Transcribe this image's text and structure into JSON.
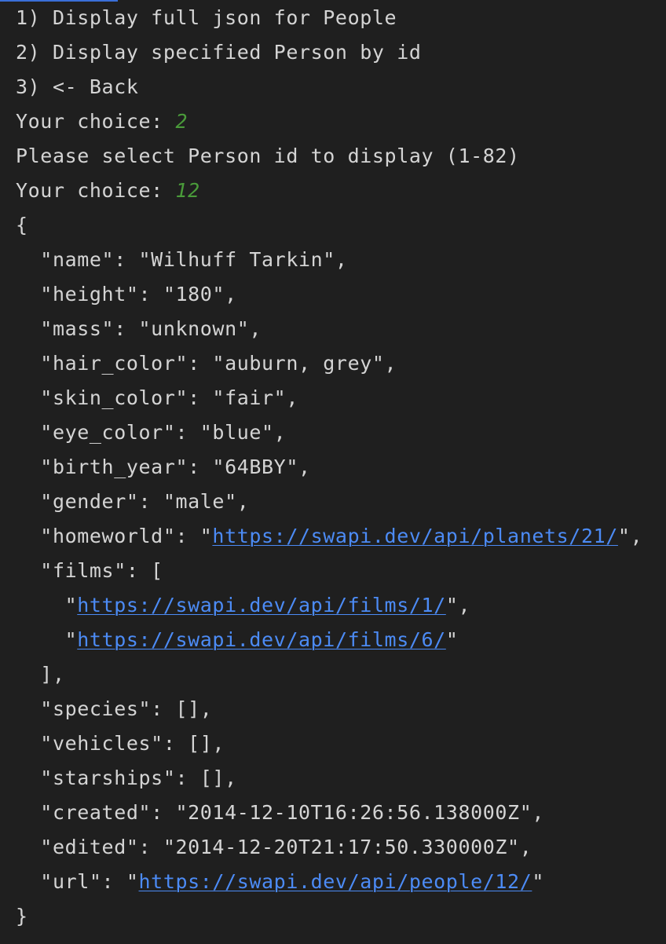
{
  "menu": {
    "option1": "1) Display full json for People",
    "option2": "2) Display specified Person by id",
    "option3": "3) <- Back"
  },
  "prompt1": {
    "label": "Your choice: ",
    "value": "2"
  },
  "select_prompt": "Please select Person id to display (1-82)",
  "prompt2": {
    "label": "Your choice: ",
    "value": "12"
  },
  "json_output": {
    "open_brace": "{",
    "name_line": "  \"name\": \"Wilhuff Tarkin\",",
    "height_line": "  \"height\": \"180\",",
    "mass_line": "  \"mass\": \"unknown\",",
    "hair_color_line": "  \"hair_color\": \"auburn, grey\",",
    "skin_color_line": "  \"skin_color\": \"fair\",",
    "eye_color_line": "  \"eye_color\": \"blue\",",
    "birth_year_line": "  \"birth_year\": \"64BBY\",",
    "gender_line": "  \"gender\": \"male\",",
    "homeworld": {
      "prefix": "  \"homeworld\": \"",
      "url": "https://swapi.dev/api/planets/21/",
      "suffix": "\","
    },
    "films_open": "  \"films\": [",
    "films": [
      {
        "prefix": "    \"",
        "url": "https://swapi.dev/api/films/1/",
        "suffix": "\","
      },
      {
        "prefix": "    \"",
        "url": "https://swapi.dev/api/films/6/",
        "suffix": "\""
      }
    ],
    "films_close": "  ],",
    "species_line": "  \"species\": [],",
    "vehicles_line": "  \"vehicles\": [],",
    "starships_line": "  \"starships\": [],",
    "created_line": "  \"created\": \"2014-12-10T16:26:56.138000Z\",",
    "edited_line": "  \"edited\": \"2014-12-20T21:17:50.330000Z\",",
    "url": {
      "prefix": "  \"url\": \"",
      "url": "https://swapi.dev/api/people/12/",
      "suffix": "\""
    },
    "close_brace": "}"
  },
  "colors": {
    "background": "#1f1f1f",
    "text": "#d4d4d4",
    "user_input": "#4a9b3a",
    "link": "#4c8bf5",
    "top_accent": "#3a6fd8"
  }
}
